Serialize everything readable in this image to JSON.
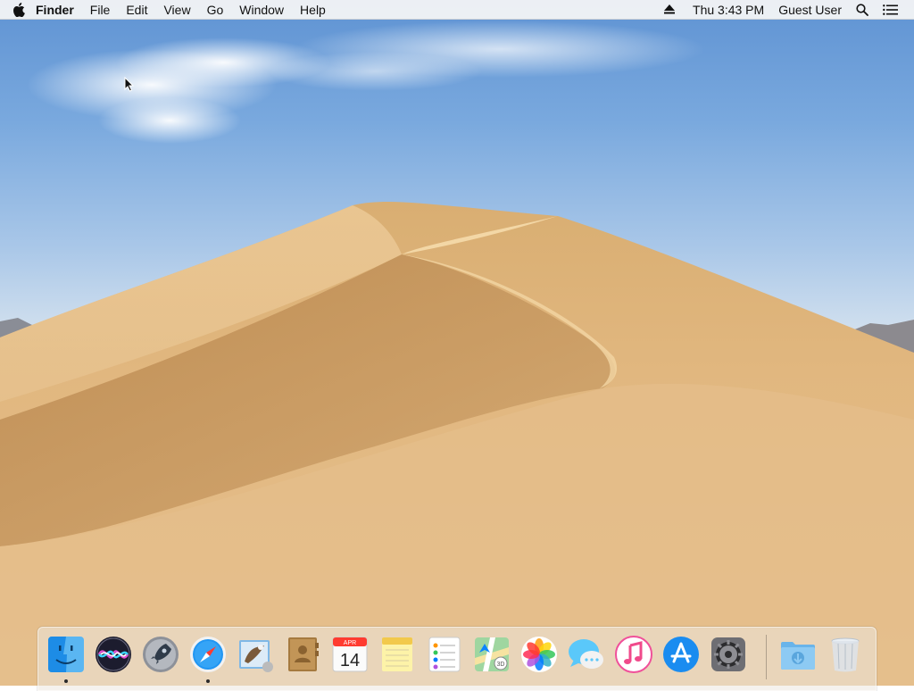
{
  "menubar": {
    "app_name": "Finder",
    "menus": [
      "File",
      "Edit",
      "View",
      "Go",
      "Window",
      "Help"
    ],
    "clock": "Thu 3:43 PM",
    "user": "Guest User",
    "icons": [
      "apple-icon",
      "eject-icon",
      "spotlight-search-icon",
      "notification-center-icon"
    ]
  },
  "dock": {
    "apps": [
      {
        "name": "Finder",
        "icon": "finder-icon",
        "running": true
      },
      {
        "name": "Siri",
        "icon": "siri-icon",
        "running": false
      },
      {
        "name": "Launchpad",
        "icon": "launchpad-icon",
        "running": false
      },
      {
        "name": "Safari",
        "icon": "safari-icon",
        "running": true
      },
      {
        "name": "Mail",
        "icon": "mail-icon",
        "running": false
      },
      {
        "name": "Contacts",
        "icon": "contacts-icon",
        "running": false
      },
      {
        "name": "Calendar",
        "icon": "calendar-icon",
        "running": false
      },
      {
        "name": "Notes",
        "icon": "notes-icon",
        "running": false
      },
      {
        "name": "Reminders",
        "icon": "reminders-icon",
        "running": false
      },
      {
        "name": "Maps",
        "icon": "maps-icon",
        "running": false
      },
      {
        "name": "Photos",
        "icon": "photos-icon",
        "running": false
      },
      {
        "name": "Messages",
        "icon": "messages-icon",
        "running": false
      },
      {
        "name": "iTunes",
        "icon": "itunes-icon",
        "running": false
      },
      {
        "name": "App Store",
        "icon": "app-store-icon",
        "running": false
      },
      {
        "name": "System Preferences",
        "icon": "system-preferences-icon",
        "running": false
      }
    ],
    "others": [
      {
        "name": "Downloads",
        "icon": "downloads-folder-icon"
      },
      {
        "name": "Trash",
        "icon": "trash-icon"
      }
    ],
    "calendar": {
      "month": "APR",
      "day": "14"
    }
  }
}
